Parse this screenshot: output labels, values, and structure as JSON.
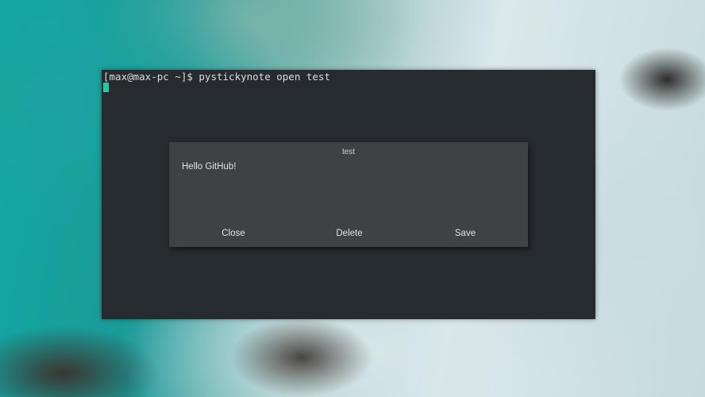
{
  "terminal": {
    "prompt": "[max@max-pc ~]$ pystickynote open test"
  },
  "note": {
    "title": "test",
    "body": "Hello GitHub!",
    "buttons": {
      "close": "Close",
      "delete": "Delete",
      "save": "Save"
    }
  }
}
